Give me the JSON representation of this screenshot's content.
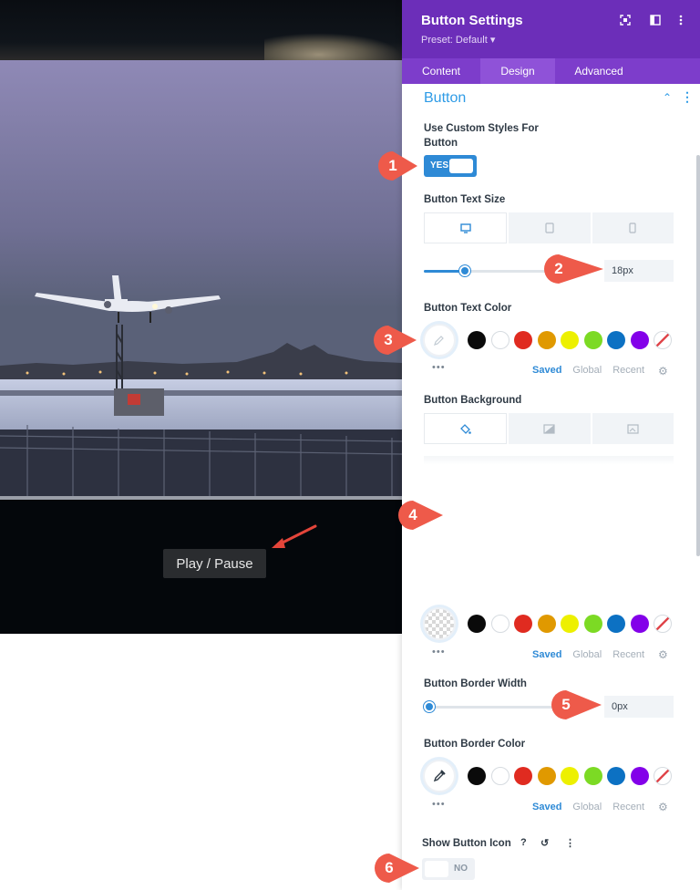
{
  "video": {
    "play_button_label": "Play / Pause"
  },
  "panel": {
    "title": "Button Settings",
    "preset": "Preset: Default ▾",
    "header_icons": [
      "focus-icon",
      "sidebar-icon",
      "more-vertical-icon"
    ],
    "tabs": [
      {
        "label": "Content",
        "active": false
      },
      {
        "label": "Design",
        "active": true
      },
      {
        "label": "Advanced",
        "active": false
      }
    ],
    "section": {
      "title": "Button"
    },
    "custom_styles": {
      "label_line1": "Use Custom Styles For",
      "label_line2": "Button",
      "toggle": "YES"
    },
    "text_size": {
      "label": "Button Text Size",
      "value": "18px",
      "slider_fraction": 0.25
    },
    "text_color": {
      "label": "Button Text Color"
    },
    "background": {
      "label": "Button Background"
    },
    "border_width": {
      "label": "Button Border Width",
      "value": "0px",
      "slider_fraction": 0.0
    },
    "border_color": {
      "label": "Button Border Color"
    },
    "show_icon": {
      "label": "Show Button Icon",
      "toggle": "NO"
    },
    "palette_tabs": [
      "Saved",
      "Global",
      "Recent"
    ],
    "more_dots": "•••"
  },
  "swatch_colors": [
    "#0a0a0a",
    "#ffffff",
    "#e02b20",
    "#e09900",
    "#edf000",
    "#7cda24",
    "#0c71c3",
    "#8300e9"
  ],
  "accent_color": "#6c2eb9",
  "annotations": [
    "1",
    "2",
    "3",
    "4",
    "5",
    "6"
  ],
  "annotation_color": "#ee5a4a"
}
